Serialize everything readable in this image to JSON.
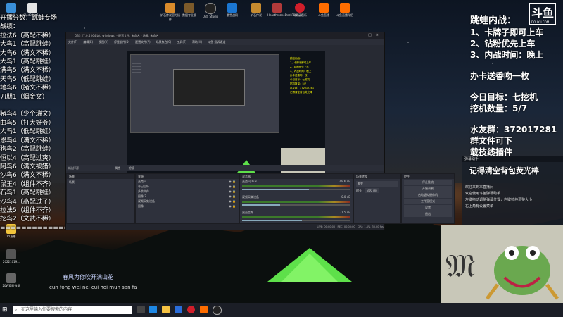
{
  "desktop": {
    "top_icons": [
      "此电脑",
      "f3ad043e1...",
      "炉石传说官方插件",
      "数据专业版",
      "OBS Studio",
      "暴雪战网",
      "炉石传说",
      "HearthstoneDeckTracker",
      "网易云音乐",
      "斗鱼直播",
      "斗鱼直播伴侣"
    ],
    "left_icons": [
      "回收站",
      "YY直播",
      "20221019...",
      "20W赛时数据"
    ]
  },
  "left_overlay": {
    "lines": [
      "开播分数：跳蛙专场",
      "战绩：",
      "拉法6（高配不稀）",
      "大鸟1（高配跳蛙）",
      "大鸟6（满文不稀）",
      "大鸟1（高配跳蛙）",
      "满鸟5（满文不稀）",
      "天鸟5（低配跳蛙）",
      "地鸟6（猪文不稀）",
      "刀朋1（烟金文）",
      "",
      "猪鸟4（少个瑞文）",
      "曲鸟5（打大好爷）",
      "大鸟1（低配跳蛙）",
      "恩鸟4（满文不稀）",
      "狗鸟2（高配跳蛙）",
      "恒以4（高配过爽）",
      "阿鸟6（满文被猎）",
      "沙鸟6（满文不稀）",
      "鼠王4（组件不齐）",
      "石鸟1（高配跳蛙）",
      "沙鸟4（高配过了）",
      "拉法5（组件不齐）",
      "挖鸟2（文武不稀）",
      "================="
    ]
  },
  "obs": {
    "title": "OBS 27.0.4 (64 bit, windows) - 配置文件: 未命名 - 场景: 未命名",
    "menu": [
      "文件(F)",
      "编辑(E)",
      "视图(V)",
      "停靠部件(D)",
      "配置文件(P)",
      "场景集合(S)",
      "工具(T)",
      "帮助(H)",
      "斗鱼·投诉通道"
    ],
    "no_source": "未选择源",
    "prop_btn": "属性",
    "filter_btn": "滤镜",
    "panels": {
      "scenes": {
        "title": "场景",
        "items": [
          "场景"
        ]
      },
      "sources": {
        "title": "来源",
        "items": [
          "麦克风",
          "今日目标",
          "多余文件",
          "图像 2",
          "视频采集设备",
          "图像"
        ]
      },
      "mixer": {
        "title": "混音器",
        "channels": [
          {
            "name": "麦克风/Aux",
            "db": "-19.6 dB",
            "level": 0.62
          },
          {
            "name": "视频采集设备",
            "db": "0.0 dB",
            "level": 0.35
          },
          {
            "name": "桌面音频",
            "db": "-1.5 dB",
            "level": 0.55
          }
        ]
      },
      "transitions": {
        "title": "场景转换",
        "type": "渐变",
        "duration_label": "时长",
        "duration": "300 ms"
      },
      "controls": {
        "title": "控件",
        "buttons": [
          "停止推流",
          "开始录制",
          "启动虚拟摄像机",
          "工作室模式",
          "设置",
          "退出"
        ]
      }
    },
    "status": {
      "live": "LIVE: 00:00:00",
      "rec": "REC: 00:00:00",
      "cpu": "CPU: 1.4%, 30.00 fps"
    }
  },
  "right_overlay": {
    "logo": "斗鱼",
    "logo_sub": "DOUYU.COM",
    "title": "跳蛙内战：",
    "rules": [
      "1、卡牌子即可上车",
      "2、钻粉优先上车",
      "3、内战时间：晚上"
    ],
    "gift": "办卡送香吻一枚",
    "goal": "今日目标：七挖机",
    "count": "挖机数量：5/7",
    "fan_group": "水友群：372017281",
    "group_file": "群文件可下",
    "plugin": "载技线插件",
    "reminder": "记得清空背包荧光棒"
  },
  "chat": {
    "header": "弹幕助手",
    "lines": [
      "欢迎来到本直播间",
      "欢迎使用斗鱼弹幕助手",
      "左键拖动调整弹幕位置，右键拉伸调整大小",
      "右上角有设置菜单"
    ]
  },
  "lyrics": {
    "line1": "春风为你吹开满山花",
    "line2": "cun fong wei nei cui hoi mun san fa"
  },
  "taskbar": {
    "search_placeholder": "在这里输入你要搜索的内容"
  },
  "colors": {
    "accent_green": "#44c23a",
    "title_panel": "#1e1f26",
    "obs_bg": "#272a33"
  }
}
